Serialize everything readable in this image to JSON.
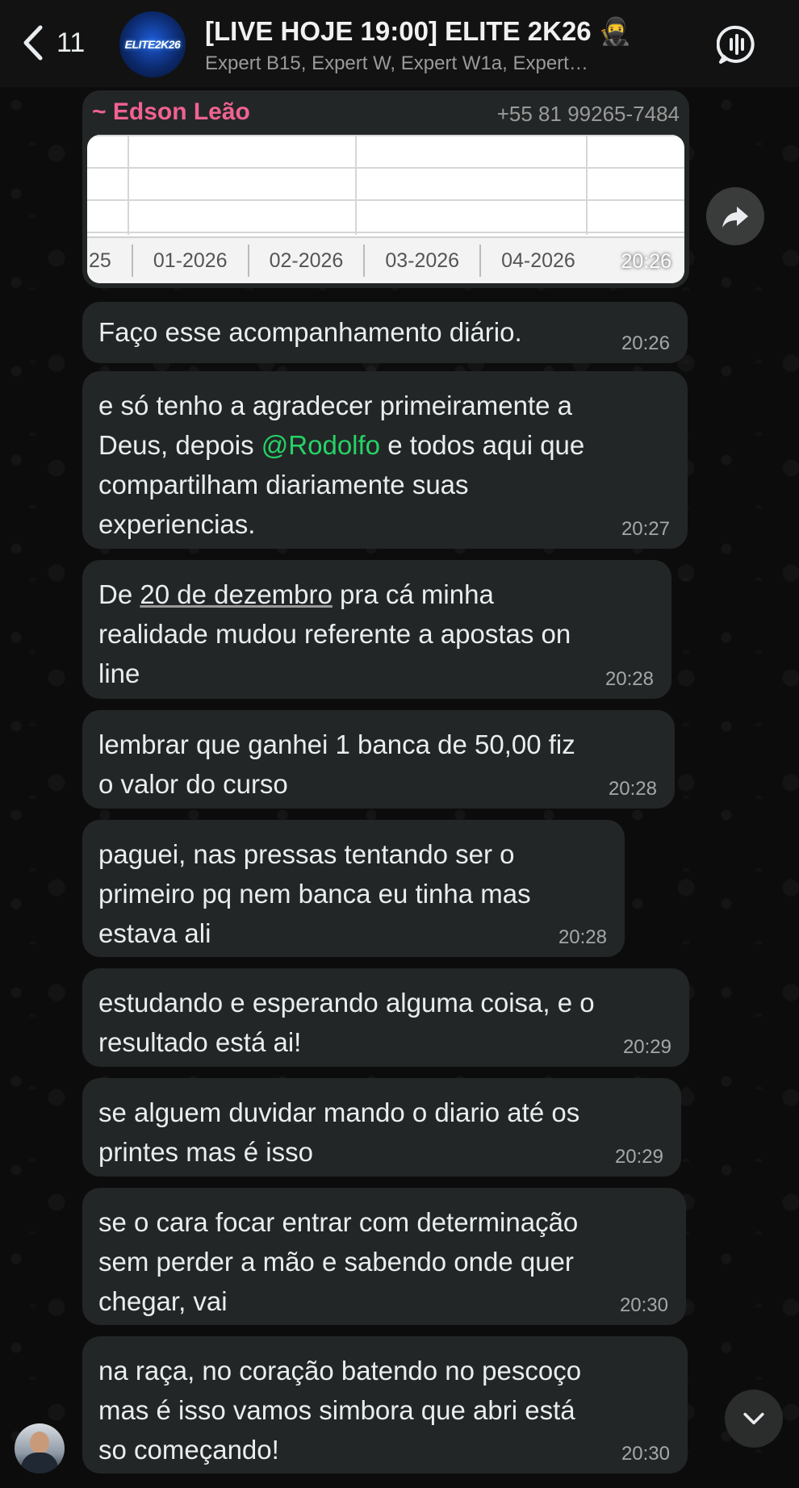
{
  "header": {
    "back_count": "11",
    "title": "[LIVE HOJE 19:00] ELITE 2K26 🥷",
    "subtitle": "Expert B15, Expert W, Expert W1a, Expert…",
    "avatar_text": "ELITE2K26"
  },
  "image_message": {
    "sender_name": "~ Edson Leão",
    "sender_phone": "+55 81 99265-7484",
    "sheet_tabs": [
      "25",
      "01-2026",
      "02-2026",
      "03-2026",
      "04-2026"
    ],
    "time": "20:26"
  },
  "messages": [
    {
      "text": "Faço esse acompanhamento diário.",
      "time": "20:26"
    },
    {
      "text_before": "e só tenho a agradecer primeiramente a\nDeus, depois ",
      "mention": "@Rodolfo",
      "text_after": " e todos aqui que\ncompartilham diariamente suas\nexperiencias.",
      "time": "20:27"
    },
    {
      "text_before": "De ",
      "date_link": "20 de dezembro",
      "text_after": " pra cá minha\nrealidade mudou referente a apostas on\nline",
      "time": "20:28"
    },
    {
      "text": "lembrar que ganhei 1 banca de 50,00 fiz\no valor do curso",
      "time": "20:28"
    },
    {
      "text": "paguei, nas pressas tentando ser o\nprimeiro pq nem banca eu tinha mas\nestava ali",
      "time": "20:28"
    },
    {
      "text": "estudando e esperando alguma coisa, e o\nresultado está ai!",
      "time": "20:29"
    },
    {
      "text": "se alguem duvidar mando o diario até os\nprintes mas é isso",
      "time": "20:29"
    },
    {
      "text": "se o cara focar entrar com determinação\nsem perder a mão e sabendo onde quer\nchegar, vai",
      "time": "20:30"
    },
    {
      "text": "na raça, no coração batendo no pescoço\nmas é isso vamos simbora que abri está\nso começando!",
      "time": "20:30"
    }
  ],
  "colors": {
    "bubble": "#232626",
    "sender_name": "#f06292",
    "mention": "#25d366",
    "background": "#0b0b0b"
  }
}
